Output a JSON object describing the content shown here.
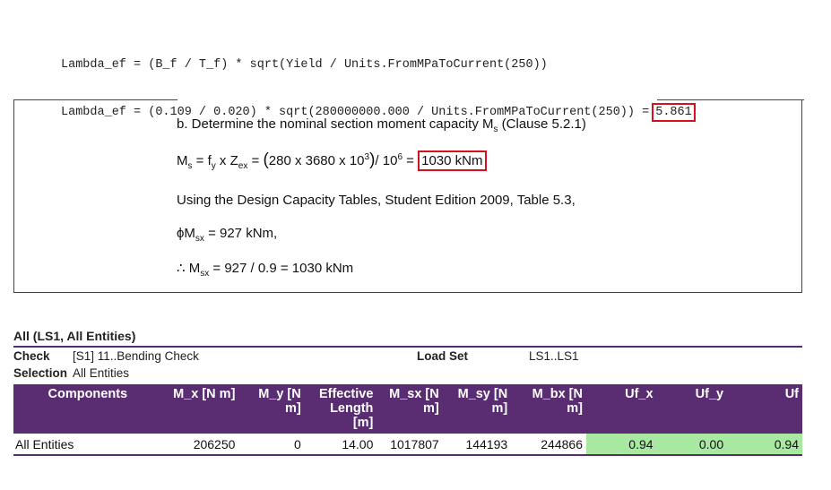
{
  "code": {
    "line1": "Lambda_ef = (B_f / T_f) * sqrt(Yield / Units.FromMPaToCurrent(250))",
    "line2": "Lambda_ef = (0.109 / 0.020) * sqrt(280000000.000 / Units.FromMPaToCurrent(250)) =",
    "result": "5.861"
  },
  "textbook": {
    "step_heading": "b. Determine the nominal section moment capacity M",
    "step_heading_sub": "s",
    "step_heading_tail": " (Clause 5.2.1)",
    "eq_lhs": "M",
    "eq_lhs_sub": "s",
    "eq_f": " = f",
    "eq_f_sub": "y",
    "eq_z": " x Z",
    "eq_z_sub": "ex",
    "eq_mid": " = ",
    "eq_num": "280 x 3680 x 10",
    "eq_num_sup": "3",
    "eq_den": "/ 10",
    "eq_den_sup": "6",
    "eq_eq": " = ",
    "eq_result": "1030 kNm",
    "table_ref": "Using the Design Capacity Tables, Student Edition 2009, Table 5.3,",
    "phi_line": "ϕM",
    "phi_sub": "sx",
    "phi_tail": " = 927 kNm,",
    "therefore": "∴ M",
    "therefore_sub": "sx",
    "therefore_tail": " = 927 / 0.9 = 1030 kNm"
  },
  "results": {
    "title": "All (LS1, All Entities)",
    "check_label": "Check",
    "check_value": "[S1] 11..Bending Check",
    "loadset_label": "Load Set",
    "loadset_value": "LS1..LS1",
    "selection_label": "Selection",
    "selection_value": "All Entities",
    "columns": [
      "Components",
      "M_x [N m]",
      "M_y [N m]",
      "Effective Length [m]",
      "M_sx [N m]",
      "M_sy [N m]",
      "M_bx [N m]",
      "Uf_x",
      "Uf_y",
      "Uf"
    ],
    "row": {
      "name": "All Entities",
      "mx": "206250",
      "my": "0",
      "length": "14.00",
      "msx": "1017807",
      "msy": "144193",
      "mbx": "244866",
      "ufx": "0.94",
      "ufy": "0.00",
      "uf": "0.94"
    },
    "status_color": "#a8e8a0",
    "header_color": "#5a2d72"
  }
}
